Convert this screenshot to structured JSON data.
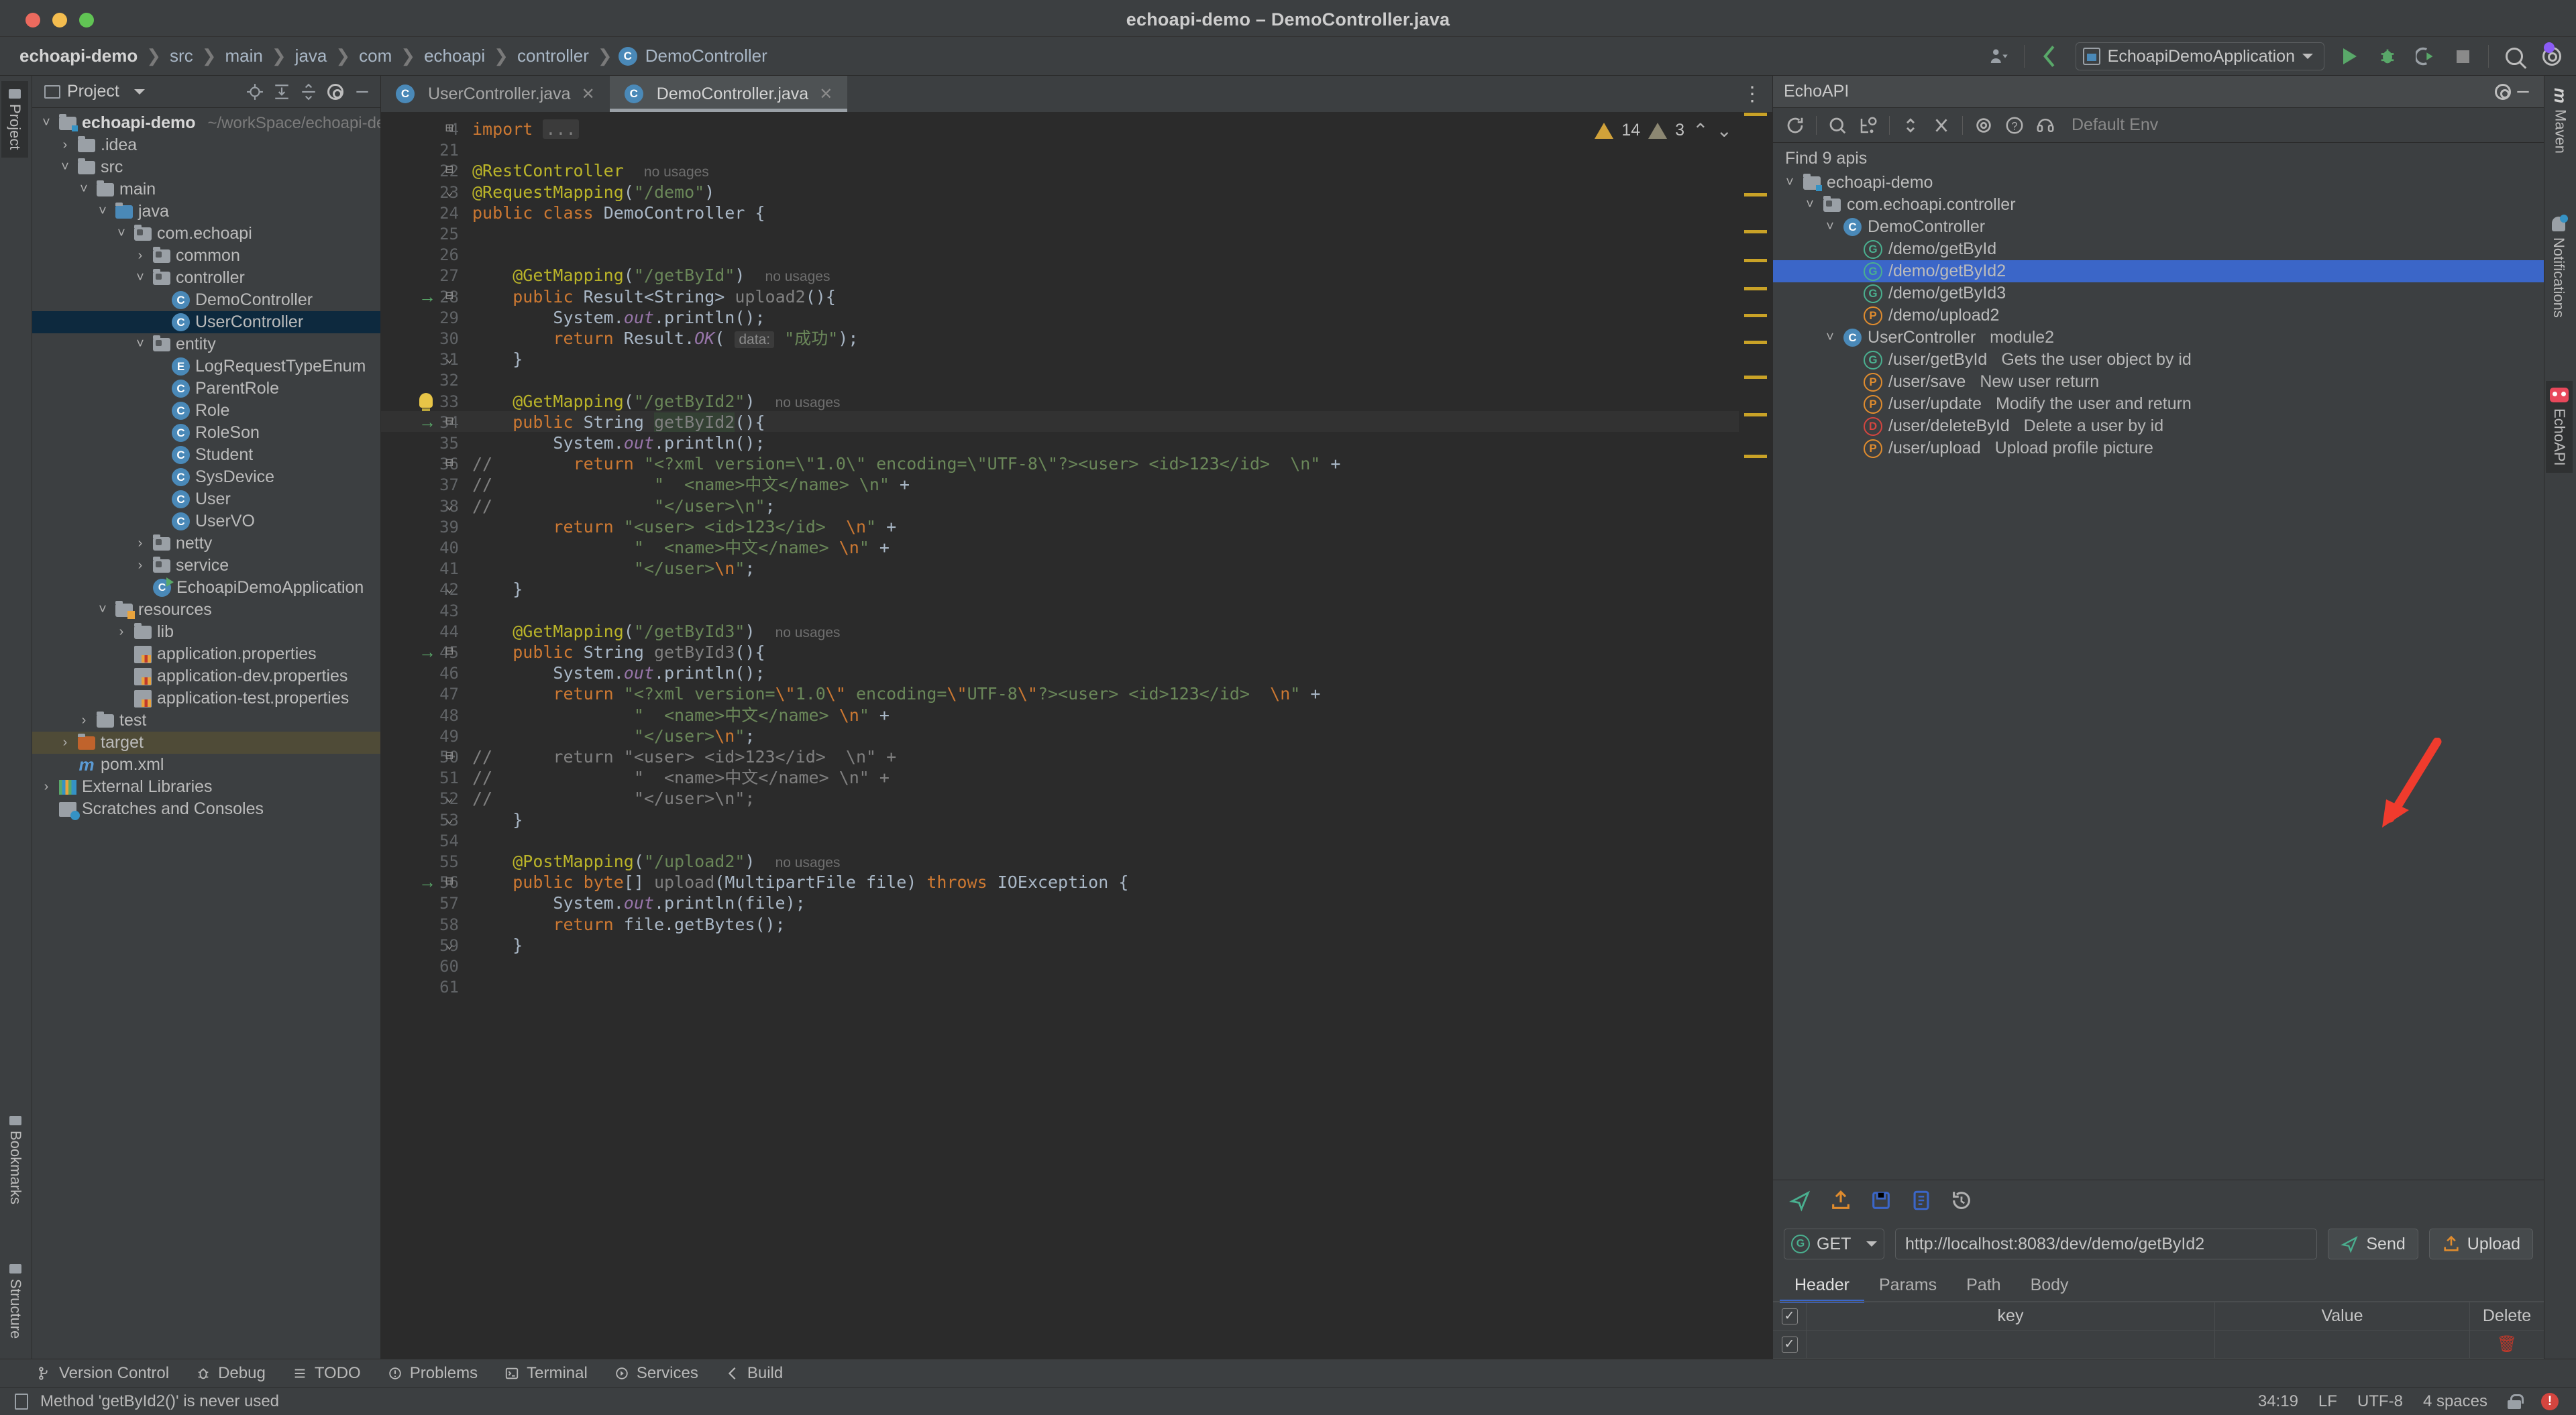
{
  "window": {
    "title": "echoapi-demo – DemoController.java"
  },
  "breadcrumb": {
    "items": [
      "echoapi-demo",
      "src",
      "main",
      "java",
      "com",
      "echoapi",
      "controller",
      "DemoController"
    ],
    "separator": "❯"
  },
  "toolbar": {
    "run_config": "EchoapiDemoApplication",
    "icons": [
      "user-avatar-icon",
      "updates-icon",
      "run-icon",
      "debug-icon",
      "run-coverage-icon",
      "stop-icon",
      "search-everywhere-icon",
      "settings-icon"
    ]
  },
  "left_rail": {
    "project_tab": "Project",
    "bookmarks_tab": "Bookmarks",
    "structure_tab": "Structure"
  },
  "project_panel": {
    "title": "Project",
    "header_icons": [
      "locate-icon",
      "expand-all-icon",
      "collapse-all-icon",
      "settings-icon",
      "hide-icon"
    ],
    "tree": [
      {
        "indent": 0,
        "arrow": "v",
        "icon": "folder-src",
        "label": "echoapi-demo",
        "bold": true,
        "path": "~/workSpace/echoapi-demo"
      },
      {
        "indent": 1,
        "arrow": ">",
        "icon": "folder",
        "label": ".idea"
      },
      {
        "indent": 1,
        "arrow": "v",
        "icon": "folder",
        "label": "src"
      },
      {
        "indent": 2,
        "arrow": "v",
        "icon": "folder",
        "label": "main"
      },
      {
        "indent": 3,
        "arrow": "v",
        "icon": "folder-java",
        "label": "java"
      },
      {
        "indent": 4,
        "arrow": "v",
        "icon": "folder-pkg",
        "label": "com.echoapi"
      },
      {
        "indent": 5,
        "arrow": ">",
        "icon": "folder-pkg",
        "label": "common"
      },
      {
        "indent": 5,
        "arrow": "v",
        "icon": "folder-pkg",
        "label": "controller"
      },
      {
        "indent": 6,
        "arrow": "",
        "icon": "class",
        "label": "DemoController"
      },
      {
        "indent": 6,
        "arrow": "",
        "icon": "class",
        "label": "UserController",
        "selected": true
      },
      {
        "indent": 5,
        "arrow": "v",
        "icon": "folder-pkg",
        "label": "entity"
      },
      {
        "indent": 6,
        "arrow": "",
        "icon": "enum",
        "label": "LogRequestTypeEnum"
      },
      {
        "indent": 6,
        "arrow": "",
        "icon": "class",
        "label": "ParentRole"
      },
      {
        "indent": 6,
        "arrow": "",
        "icon": "class",
        "label": "Role"
      },
      {
        "indent": 6,
        "arrow": "",
        "icon": "class",
        "label": "RoleSon"
      },
      {
        "indent": 6,
        "arrow": "",
        "icon": "class",
        "label": "Student"
      },
      {
        "indent": 6,
        "arrow": "",
        "icon": "class",
        "label": "SysDevice"
      },
      {
        "indent": 6,
        "arrow": "",
        "icon": "class",
        "label": "User"
      },
      {
        "indent": 6,
        "arrow": "",
        "icon": "class",
        "label": "UserVO"
      },
      {
        "indent": 5,
        "arrow": ">",
        "icon": "folder-pkg",
        "label": "netty"
      },
      {
        "indent": 5,
        "arrow": ">",
        "icon": "folder-pkg",
        "label": "service"
      },
      {
        "indent": 5,
        "arrow": "",
        "icon": "class-run",
        "label": "EchoapiDemoApplication"
      },
      {
        "indent": 3,
        "arrow": "v",
        "icon": "folder-res",
        "label": "resources"
      },
      {
        "indent": 4,
        "arrow": ">",
        "icon": "folder",
        "label": "lib"
      },
      {
        "indent": 4,
        "arrow": "",
        "icon": "properties",
        "label": "application.properties"
      },
      {
        "indent": 4,
        "arrow": "",
        "icon": "properties",
        "label": "application-dev.properties"
      },
      {
        "indent": 4,
        "arrow": "",
        "icon": "properties",
        "label": "application-test.properties"
      },
      {
        "indent": 2,
        "arrow": ">",
        "icon": "folder",
        "label": "test"
      },
      {
        "indent": 1,
        "arrow": ">",
        "icon": "folder-target",
        "label": "target",
        "highlighted": true
      },
      {
        "indent": 1,
        "arrow": "",
        "icon": "maven",
        "label": "pom.xml"
      },
      {
        "indent": 0,
        "arrow": ">",
        "icon": "libraries",
        "label": "External Libraries"
      },
      {
        "indent": 0,
        "arrow": "",
        "icon": "scratches",
        "label": "Scratches and Consoles"
      }
    ]
  },
  "editor": {
    "tabs": [
      {
        "label": "UserController.java",
        "active": false
      },
      {
        "label": "DemoController.java",
        "active": true
      }
    ],
    "warnings": {
      "yellow": "14",
      "grey": "3"
    },
    "lines": [
      {
        "n": "4",
        "html": "<span class=\"kw\">import</span> <span class=\"imp-ellip\">...</span>",
        "fold": "+"
      },
      {
        "n": "21",
        "html": ""
      },
      {
        "n": "22",
        "html": "<span class=\"ann\">@RestController</span>  <span class=\"nousage\">no usages</span>",
        "fold": "-"
      },
      {
        "n": "23",
        "html": "<span class=\"ann\">@RequestMapping</span>(<span class=\"str\">\"/demo\"</span>)",
        "fold": "^"
      },
      {
        "n": "24",
        "html": "<span class=\"kw\">public class</span> <span class=\"cls\">DemoController</span> {"
      },
      {
        "n": "25",
        "html": ""
      },
      {
        "n": "26",
        "html": ""
      },
      {
        "n": "27",
        "html": "    <span class=\"ann\">@GetMapping</span>(<span class=\"str\">\"/getById\"</span>)  <span class=\"nousage\">no usages</span>"
      },
      {
        "n": "28",
        "html": "    <span class=\"kw\">public</span> Result&lt;String&gt; <span class=\"gray\">upload2</span>(){",
        "run": true,
        "fold": "-"
      },
      {
        "n": "29",
        "html": "        System.<span class=\"fld\">out</span>.println();"
      },
      {
        "n": "30",
        "html": "        <span class=\"kw\">return</span> Result.<span class=\"fld\">OK</span>( <span class=\"hintlbl\">data:</span> <span class=\"str\">\"成功\"</span>);"
      },
      {
        "n": "31",
        "html": "    }",
        "fold": "^"
      },
      {
        "n": "32",
        "html": ""
      },
      {
        "n": "33",
        "html": "    <span class=\"ann\">@GetMapping</span>(<span class=\"str\">\"/getById2\"</span>)  <span class=\"nousage\">no usages</span>",
        "bulb": true
      },
      {
        "n": "34",
        "html": "    <span class=\"kw\">public</span> String <span class=\"sel-tok gray\">getById2</span>(){",
        "run": true,
        "current": true,
        "fold": "-"
      },
      {
        "n": "35",
        "html": "        System.<span class=\"fld\">out</span>.println();"
      },
      {
        "n": "36",
        "html": "<span class=\"cmt\">//</span>        <span class=\"kw\">return</span> <span class=\"str\">\"&lt;?xml version=\\\"1.0\\\" encoding=\\\"UTF-8\\\"?&gt;&lt;user&gt; &lt;id&gt;123&lt;/id&gt;  \\n\"</span> +",
        "fold": "-",
        "comment_col": true
      },
      {
        "n": "37",
        "html": "<span class=\"cmt\">//</span>                <span class=\"str\">\"  &lt;name&gt;中文&lt;/name&gt; \\n\"</span> +",
        "comment_col": true
      },
      {
        "n": "38",
        "html": "<span class=\"cmt\">//</span>                <span class=\"str\">\"&lt;/user&gt;\\n\"</span>;",
        "fold": "^",
        "comment_col": true
      },
      {
        "n": "39",
        "html": "        <span class=\"kw\">return</span> <span class=\"str\">\"&lt;user&gt; &lt;id&gt;123&lt;/id&gt;  </span><span class=\"esc\">\\n</span><span class=\"str\">\"</span> +"
      },
      {
        "n": "40",
        "html": "                <span class=\"str\">\"  &lt;name&gt;中文&lt;/name&gt; </span><span class=\"esc\">\\n</span><span class=\"str\">\"</span> +"
      },
      {
        "n": "41",
        "html": "                <span class=\"str\">\"&lt;/user&gt;</span><span class=\"esc\">\\n</span><span class=\"str\">\"</span>;"
      },
      {
        "n": "42",
        "html": "    }",
        "fold": "^"
      },
      {
        "n": "43",
        "html": ""
      },
      {
        "n": "44",
        "html": "    <span class=\"ann\">@GetMapping</span>(<span class=\"str\">\"/getById3\"</span>)  <span class=\"nousage\">no usages</span>"
      },
      {
        "n": "45",
        "html": "    <span class=\"kw\">public</span> String <span class=\"gray\">getById3</span>(){",
        "run": true,
        "fold": "-"
      },
      {
        "n": "46",
        "html": "        System.<span class=\"fld\">out</span>.println();"
      },
      {
        "n": "47",
        "html": "        <span class=\"kw\">return</span> <span class=\"str\">\"&lt;?xml version=</span><span class=\"esc\">\\\"</span><span class=\"str\">1.0</span><span class=\"esc\">\\\"</span><span class=\"str\"> encoding=</span><span class=\"esc\">\\\"</span><span class=\"str\">UTF-8</span><span class=\"esc\">\\\"</span><span class=\"str\">?&gt;&lt;user&gt; &lt;id&gt;123&lt;/id&gt;  </span><span class=\"esc\">\\n</span><span class=\"str\">\"</span> +"
      },
      {
        "n": "48",
        "html": "                <span class=\"str\">\"  &lt;name&gt;中文&lt;/name&gt; </span><span class=\"esc\">\\n</span><span class=\"str\">\"</span> +"
      },
      {
        "n": "49",
        "html": "                <span class=\"str\">\"&lt;/user&gt;</span><span class=\"esc\">\\n</span><span class=\"str\">\"</span>;"
      },
      {
        "n": "50",
        "html": "<span class=\"cmt\">//</span>      <span class=\"cmt\">return \"&lt;user&gt; &lt;id&gt;123&lt;/id&gt;  \\n\" +</span>",
        "fold": "-",
        "comment_col": true
      },
      {
        "n": "51",
        "html": "<span class=\"cmt\">//</span>              <span class=\"cmt\">\"  &lt;name&gt;中文&lt;/name&gt; \\n\" +</span>",
        "comment_col": true
      },
      {
        "n": "52",
        "html": "<span class=\"cmt\">//</span>              <span class=\"cmt\">\"&lt;/user&gt;\\n\";</span>",
        "fold": "^",
        "comment_col": true
      },
      {
        "n": "53",
        "html": "    }",
        "fold": "^"
      },
      {
        "n": "54",
        "html": ""
      },
      {
        "n": "55",
        "html": "    <span class=\"ann\">@PostMapping</span>(<span class=\"str\">\"/upload2\"</span>)  <span class=\"nousage\">no usages</span>"
      },
      {
        "n": "56",
        "html": "    <span class=\"kw\">public byte</span>[] <span class=\"gray\">upload</span>(MultipartFile file) <span class=\"kw\">throws</span> IOException {",
        "run": true,
        "fold": "-"
      },
      {
        "n": "57",
        "html": "        System.<span class=\"fld\">out</span>.println(file);"
      },
      {
        "n": "58",
        "html": "        <span class=\"kw\">return</span> file.getBytes();"
      },
      {
        "n": "59",
        "html": "    }",
        "fold": "^"
      },
      {
        "n": "60",
        "html": ""
      },
      {
        "n": "61",
        "html": ""
      }
    ]
  },
  "echoapi": {
    "title": "EchoAPI",
    "toolbar_icons": [
      "refresh-icon",
      "search-icon",
      "add-api-icon",
      "expand-collapse-icon",
      "close-icon",
      "settings-icon",
      "help-icon",
      "support-icon"
    ],
    "env_label": "Default Env",
    "find_label": "Find 9 apis",
    "tree": [
      {
        "indent": 0,
        "arrow": "v",
        "icon": "folder-src",
        "label": "echoapi-demo"
      },
      {
        "indent": 1,
        "arrow": "v",
        "icon": "folder-pkg",
        "label": "com.echoapi.controller"
      },
      {
        "indent": 2,
        "arrow": "v",
        "icon": "class",
        "label": "DemoController"
      },
      {
        "indent": 3,
        "arrow": "",
        "icon": "get",
        "label": "/demo/getById"
      },
      {
        "indent": 3,
        "arrow": "",
        "icon": "get",
        "label": "/demo/getById2",
        "selected": true
      },
      {
        "indent": 3,
        "arrow": "",
        "icon": "get",
        "label": "/demo/getById3"
      },
      {
        "indent": 3,
        "arrow": "",
        "icon": "post",
        "label": "/demo/upload2"
      },
      {
        "indent": 2,
        "arrow": "v",
        "icon": "class",
        "label": "UserController",
        "module": "module2"
      },
      {
        "indent": 3,
        "arrow": "",
        "icon": "get",
        "label": "/user/getById",
        "desc": "Gets the user object by id"
      },
      {
        "indent": 3,
        "arrow": "",
        "icon": "post",
        "label": "/user/save",
        "desc": "New user return"
      },
      {
        "indent": 3,
        "arrow": "",
        "icon": "post",
        "label": "/user/update",
        "desc": "Modify the user and return"
      },
      {
        "indent": 3,
        "arrow": "",
        "icon": "delete",
        "label": "/user/deleteById",
        "desc": "Delete a user by id"
      },
      {
        "indent": 3,
        "arrow": "",
        "icon": "post",
        "label": "/user/upload",
        "desc": "Upload profile picture"
      }
    ],
    "action_icons": [
      "send-plane-icon",
      "upload-icon",
      "save-icon",
      "doc-icon",
      "history-icon"
    ],
    "request": {
      "method": "GET",
      "url": "http://localhost:8083/dev/demo/getById2",
      "send_label": "Send",
      "upload_label": "Upload"
    },
    "request_tabs": [
      {
        "label": "Header",
        "active": true
      },
      {
        "label": "Params",
        "active": false
      },
      {
        "label": "Path",
        "active": false
      },
      {
        "label": "Body",
        "active": false
      }
    ],
    "header_table": {
      "columns": [
        "key",
        "Value",
        "Delete"
      ],
      "rows": [
        {
          "checked": true,
          "key": "",
          "value": ""
        }
      ]
    }
  },
  "right_rail": {
    "items": [
      {
        "label": "Maven",
        "icon": "maven-icon",
        "active": false
      },
      {
        "label": "Notifications",
        "icon": "bell-icon",
        "active": false
      },
      {
        "label": "EchoAPI",
        "icon": "echoapi-logo-icon",
        "active": true
      }
    ]
  },
  "bottom_tools": [
    {
      "label": "Version Control",
      "icon": "branch-icon"
    },
    {
      "label": "Debug",
      "icon": "bug-icon"
    },
    {
      "label": "TODO",
      "icon": "list-icon"
    },
    {
      "label": "Problems",
      "icon": "warning-icon"
    },
    {
      "label": "Terminal",
      "icon": "terminal-icon"
    },
    {
      "label": "Services",
      "icon": "services-icon"
    },
    {
      "label": "Build",
      "icon": "build-icon"
    }
  ],
  "status_bar": {
    "message": "Method 'getById2()' is never used",
    "caret": "34:19",
    "line_sep": "LF",
    "encoding": "UTF-8",
    "indent": "4 spaces"
  },
  "annotation": {
    "arrow_color": "#f03b2d"
  }
}
